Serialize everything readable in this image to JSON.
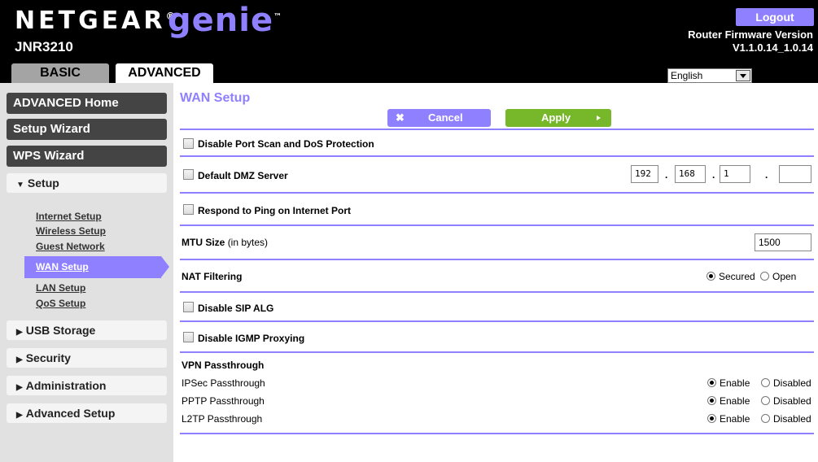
{
  "header": {
    "brand": "NETGEAR",
    "product": "genie",
    "model": "JNR3210",
    "logout_label": "Logout",
    "firmware_label": "Router Firmware Version",
    "firmware_version": "V1.1.0.14_1.0.14",
    "tabs": [
      {
        "label": "BASIC",
        "active": false
      },
      {
        "label": "ADVANCED",
        "active": true
      }
    ],
    "language": "English"
  },
  "sidebar": {
    "top_buttons": [
      {
        "label": "ADVANCED Home"
      },
      {
        "label": "Setup Wizard"
      },
      {
        "label": "WPS Wizard"
      }
    ],
    "setup_section": "Setup",
    "setup_links": [
      {
        "label": "Internet Setup"
      },
      {
        "label": "Wireless Setup"
      },
      {
        "label": "Guest Network"
      },
      {
        "label": "WAN Setup",
        "active": true
      },
      {
        "label": "LAN Setup"
      },
      {
        "label": "QoS Setup"
      }
    ],
    "sections": [
      {
        "label": "USB Storage"
      },
      {
        "label": "Security"
      },
      {
        "label": "Administration"
      },
      {
        "label": "Advanced Setup"
      }
    ]
  },
  "main": {
    "title": "WAN Setup",
    "cancel_label": "Cancel",
    "apply_label": "Apply",
    "disable_port_scan": {
      "label": "Disable Port Scan and DoS Protection",
      "checked": false
    },
    "default_dmz": {
      "label": "Default DMZ Server",
      "checked": false,
      "ip": [
        "192",
        "168",
        "1",
        ""
      ]
    },
    "respond_ping": {
      "label": "Respond to Ping on Internet Port",
      "checked": false
    },
    "mtu": {
      "label": "MTU Size",
      "unit": "(in bytes)",
      "value": "1500"
    },
    "nat_filtering": {
      "label": "NAT Filtering",
      "options": [
        "Secured",
        "Open"
      ],
      "selected": "Secured"
    },
    "disable_sip_alg": {
      "label": "Disable SIP ALG",
      "checked": false
    },
    "disable_igmp": {
      "label": "Disable IGMP Proxying",
      "checked": false
    },
    "vpn": {
      "heading": "VPN Passthrough",
      "enable_label": "Enable",
      "disabled_label": "Disabled",
      "rows": [
        {
          "label": "IPSec Passthrough",
          "selected": "Enable"
        },
        {
          "label": "PPTP Passthrough",
          "selected": "Enable"
        },
        {
          "label": "L2TP Passthrough",
          "selected": "Enable"
        }
      ]
    }
  },
  "colors": {
    "accent": "#8f80ff",
    "apply_green": "#76b82a",
    "header_bg": "#000000",
    "sidebar_bg": "#e1e1e1",
    "sidebar_dark": "#444444"
  }
}
